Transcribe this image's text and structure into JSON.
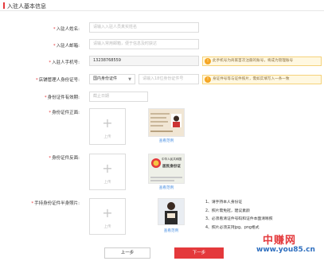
{
  "header": {
    "title": "入驻人基本信息"
  },
  "form": {
    "name": {
      "label": "入驻人姓名:",
      "placeholder": "请输入入驻人员真实姓名"
    },
    "email": {
      "label": "入驻人邮箱:",
      "placeholder": "请输入常用邮箱，便于信息及时获达"
    },
    "phone": {
      "label": "入驻人手机号:",
      "value": "13238768559",
      "tip": "此手机号为商家首次注册的账号，将成为管理账号"
    },
    "id_type": {
      "label": "店铺管理人身份证号:",
      "selected": "国内身份证件",
      "placeholder": "请输入18位身份证件号",
      "tip": "身证件号等与证件照片，需如实填写入一条一致"
    },
    "id_expiry": {
      "label": "身份证件有效期:",
      "placeholder": "截止日期"
    },
    "id_front": {
      "label": "身份证件正面:",
      "upload_label": "上传",
      "sample_link": "查看范例"
    },
    "id_back": {
      "label": "身份证件反面:",
      "upload_label": "上传",
      "sample_link": "查看范例"
    },
    "id_handheld": {
      "label": "手持身份证件半身照片:",
      "upload_label": "上传",
      "sample_link": "查看范例"
    }
  },
  "notes": [
    "1、请手持本人身份证",
    "2、照片需免冠，建议素颜",
    "3、必须看清证件号码和证件本面清晰照",
    "4、照片必须支持jpg、png格式"
  ],
  "sample_card": {
    "back_title": "中华人民共和国",
    "back_subtitle": "居民身份证"
  },
  "buttons": {
    "prev": "上一步",
    "next": "下一步"
  },
  "watermark": {
    "cn": "中赚网",
    "url": "www.you85.cn"
  },
  "colors": {
    "accent": "#e4393c",
    "link": "#4a90e2",
    "tip_bg": "#fff8e1",
    "tip_icon": "#f5a623"
  },
  "icons": {
    "tip": "warning-icon",
    "upload": "plus-icon"
  }
}
